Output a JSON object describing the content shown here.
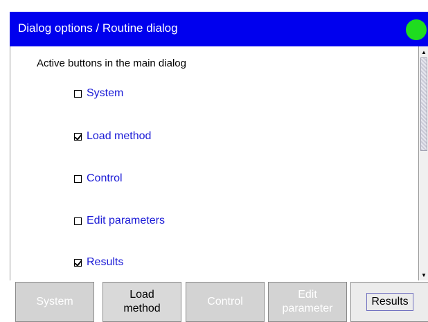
{
  "window": {
    "title": "Dialog options / Routine dialog",
    "status_color": "#1fdc1f"
  },
  "content": {
    "section_label": "Active buttons in the main dialog",
    "options": [
      {
        "label": "System",
        "checked": false
      },
      {
        "label": "Load method",
        "checked": true
      },
      {
        "label": "Control",
        "checked": false
      },
      {
        "label": "Edit parameters",
        "checked": false
      },
      {
        "label": "Results",
        "checked": true
      }
    ]
  },
  "buttons": [
    {
      "label": "System",
      "enabled": false
    },
    {
      "label": "Load\nmethod",
      "enabled": true
    },
    {
      "label": "Control",
      "enabled": false
    },
    {
      "label": "Edit\nparameter",
      "enabled": false
    },
    {
      "label": "Results",
      "enabled": true,
      "focused": true
    }
  ],
  "colors": {
    "titlebar": "#0000ee",
    "option_text": "#1a1ad6"
  }
}
